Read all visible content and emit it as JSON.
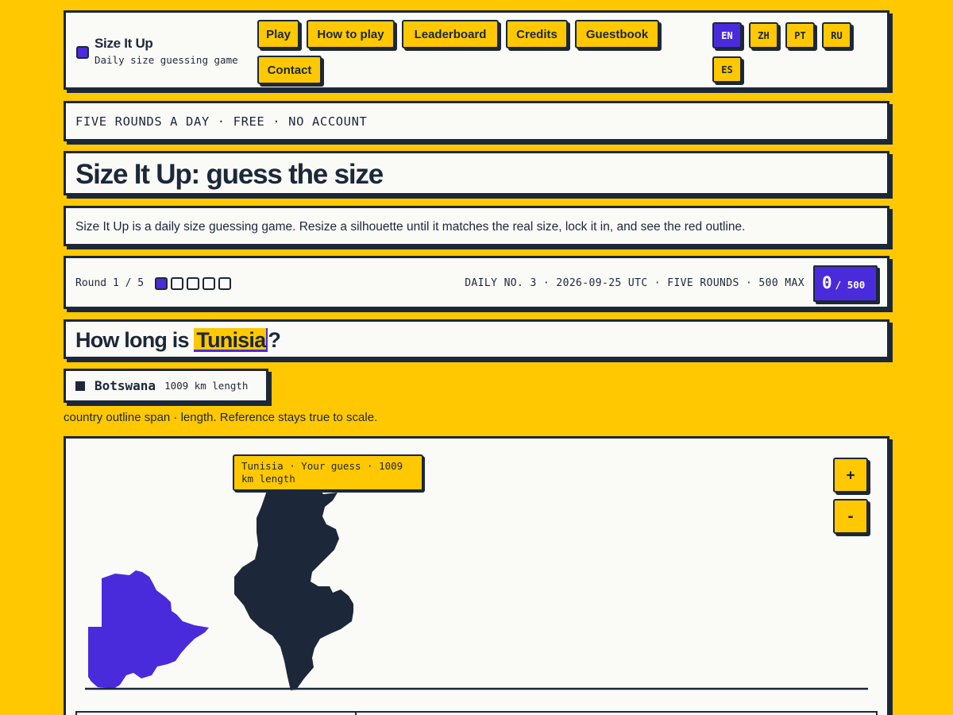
{
  "header": {
    "brand_name": "Size It Up",
    "brand_tagline": "Daily size guessing game",
    "nav": [
      "Play",
      "How to play",
      "Leaderboard",
      "Credits",
      "Guestbook",
      "Contact"
    ],
    "languages": [
      "EN",
      "ZH",
      "PT",
      "RU",
      "ES"
    ],
    "active_language": "EN"
  },
  "banner": "FIVE ROUNDS A DAY · FREE · NO ACCOUNT",
  "title": "Size It Up: guess the size",
  "description": "Size It Up is a daily size guessing game. Resize a silhouette until it matches the real size, lock it in, and see the red outline.",
  "status": {
    "round_text": "Round 1 / 5",
    "rounds_total": 5,
    "rounds_done": 1,
    "daily_info": "DAILY NO. 3 · 2026-09-25 UTC · FIVE ROUNDS · 500 MAX",
    "score": "0",
    "score_max": "/ 500"
  },
  "question": {
    "prefix": "How long is ",
    "subject": "Tunisia",
    "suffix": "?"
  },
  "reference": {
    "name": "Botswana",
    "value": "1009 km length"
  },
  "hint": "country outline span · length. Reference stays true to scale.",
  "stage": {
    "tooltip": "Tunisia · Your guess · 1009 km length",
    "zoom_in": "+",
    "zoom_out": "-"
  },
  "colors": {
    "background": "#ffc800",
    "ink": "#1c2839",
    "accent": "#4a2bdc",
    "card": "#fafaf7"
  }
}
